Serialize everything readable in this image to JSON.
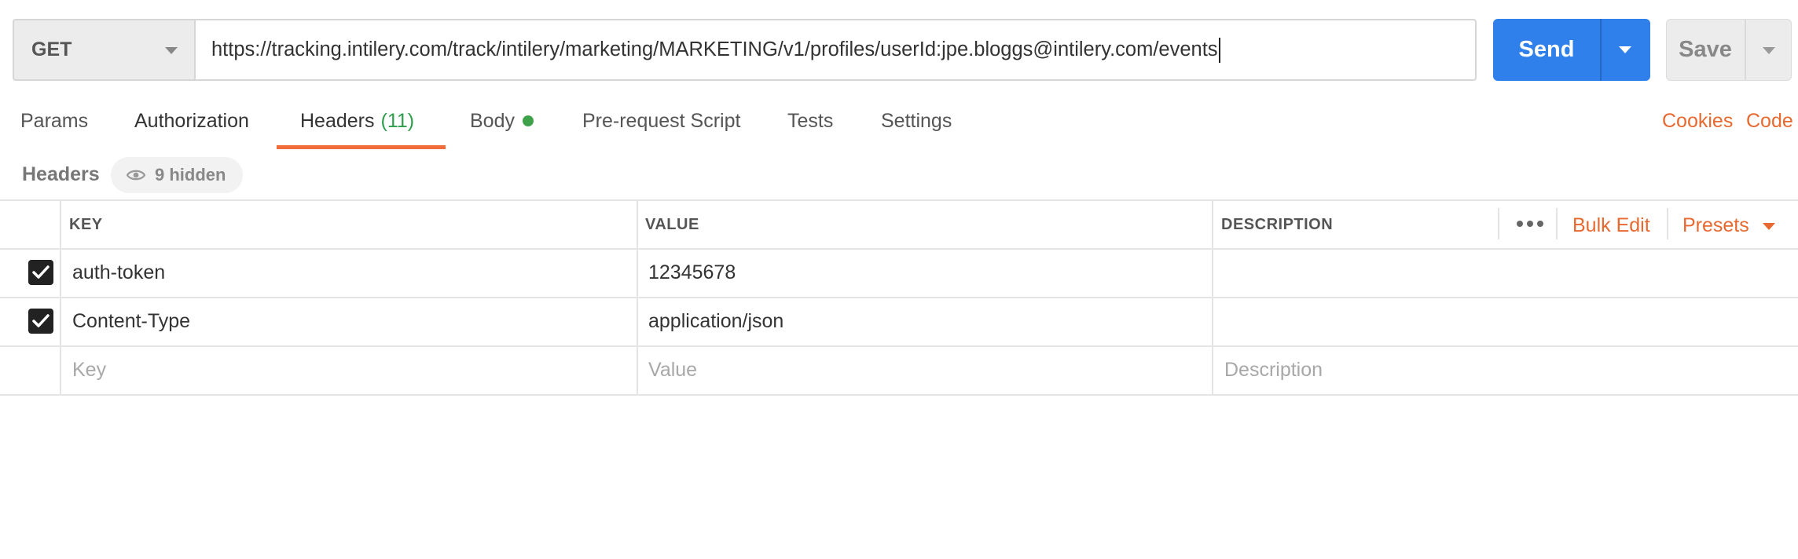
{
  "request": {
    "method": "GET",
    "url": "https://tracking.intilery.com/track/intilery/marketing/MARKETING/v1/profiles/userId:jpe.bloggs@intilery.com/events",
    "send_label": "Send",
    "save_label": "Save"
  },
  "tabs": {
    "params": "Params",
    "authorization": "Authorization",
    "headers": "Headers",
    "headers_count": "(11)",
    "body": "Body",
    "prerequest": "Pre-request Script",
    "tests": "Tests",
    "settings": "Settings",
    "active": "headers"
  },
  "links": {
    "cookies": "Cookies",
    "code": "Code"
  },
  "headers_section": {
    "title": "Headers",
    "hidden_label": "9 hidden"
  },
  "table": {
    "columns": {
      "key": "KEY",
      "value": "VALUE",
      "description": "DESCRIPTION"
    },
    "actions": {
      "bulk_edit": "Bulk Edit",
      "presets": "Presets"
    },
    "rows": [
      {
        "checked": true,
        "key": "auth-token",
        "value": "12345678",
        "description": ""
      },
      {
        "checked": true,
        "key": "Content-Type",
        "value": "application/json",
        "description": ""
      }
    ],
    "placeholders": {
      "key": "Key",
      "value": "Value",
      "description": "Description"
    }
  },
  "colors": {
    "accent_orange": "#e8692f",
    "send_blue": "#2f80ea",
    "count_green": "#2e9e4d",
    "body_dot_green": "#3ea24a"
  }
}
